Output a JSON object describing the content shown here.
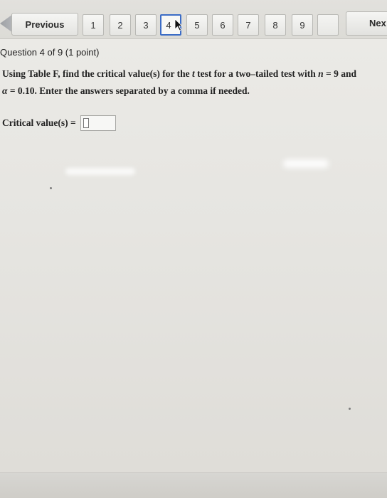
{
  "nav": {
    "previous_label": "Previous",
    "pages": [
      "1",
      "2",
      "3",
      "4",
      "5",
      "6",
      "7",
      "8",
      "9",
      "",
      ""
    ],
    "current_page": "4",
    "next_label": "Nex"
  },
  "question": {
    "header": "Question 4 of 9 (1 point)",
    "text_line1_pre": "Using Table F, find the critical value(s) for the",
    "text_line1_var": "t",
    "text_line1_mid": "test for a two–tailed test with",
    "text_line1_n": "n",
    "text_line1_post": "= 9 and",
    "text_line2_alpha": "α",
    "text_line2_post": "= 0.10. Enter the answers separated by a comma if needed.",
    "answer_label": "Critical value(s) =",
    "answer_value": ""
  },
  "colors": {
    "current_page_border": "#3b6cc6"
  }
}
